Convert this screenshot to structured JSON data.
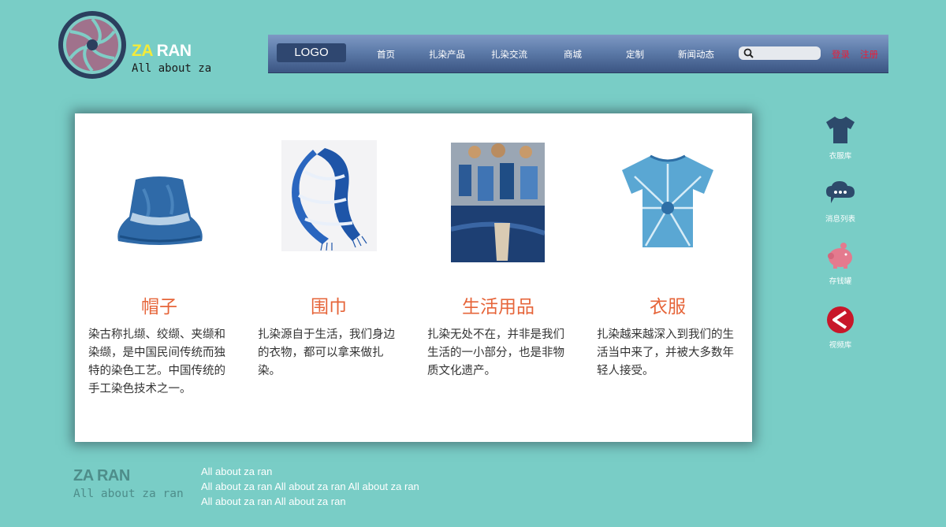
{
  "brand": {
    "za": "ZA",
    "ran": "RAN",
    "tagline": "All about za"
  },
  "nav": {
    "logo": "LOGO",
    "items": [
      "首页",
      "扎染产品",
      "扎染交流",
      "商城",
      "定制",
      "新闻动态"
    ],
    "search_placeholder": "",
    "login": "登录",
    "register": "注册"
  },
  "products": [
    {
      "title": "帽子",
      "desc": "染古称扎缬、绞缬、夹缬和染缬，是中国民间传统而独特的染色工艺。中国传统的手工染色技术之一。"
    },
    {
      "title": "围巾",
      "desc": "扎染源自于生活，我们身边的衣物，都可以拿来做扎染。"
    },
    {
      "title": "生活用品",
      "desc": "扎染无处不在，并非是我们生活的一小部分，也是非物质文化遗产。"
    },
    {
      "title": "衣服",
      "desc": "扎染越来越深入到我们的生活当中来了，并被大多数年轻人接受。"
    }
  ],
  "sidebar": [
    {
      "label": "衣服库",
      "icon": "tshirt-icon",
      "color": "#2d4a6b"
    },
    {
      "label": "消息列表",
      "icon": "chat-bubble-icon",
      "color": "#2d4a6b"
    },
    {
      "label": "存钱罐",
      "icon": "piggy-bank-icon",
      "color": "#e47a8e"
    },
    {
      "label": "视频库",
      "icon": "back-arrow-icon",
      "color": "#c8172a"
    }
  ],
  "footer": {
    "brand": "ZA RAN",
    "tagline": "All about za ran",
    "lines": [
      "All about za ran",
      "All about za ran All about za ran All about za ran",
      "All about za ran All about za ran"
    ]
  },
  "colors": {
    "background": "#79cdc6",
    "accent": "#e6653a",
    "nav": "#3b5583",
    "auth": "#e8203a"
  }
}
